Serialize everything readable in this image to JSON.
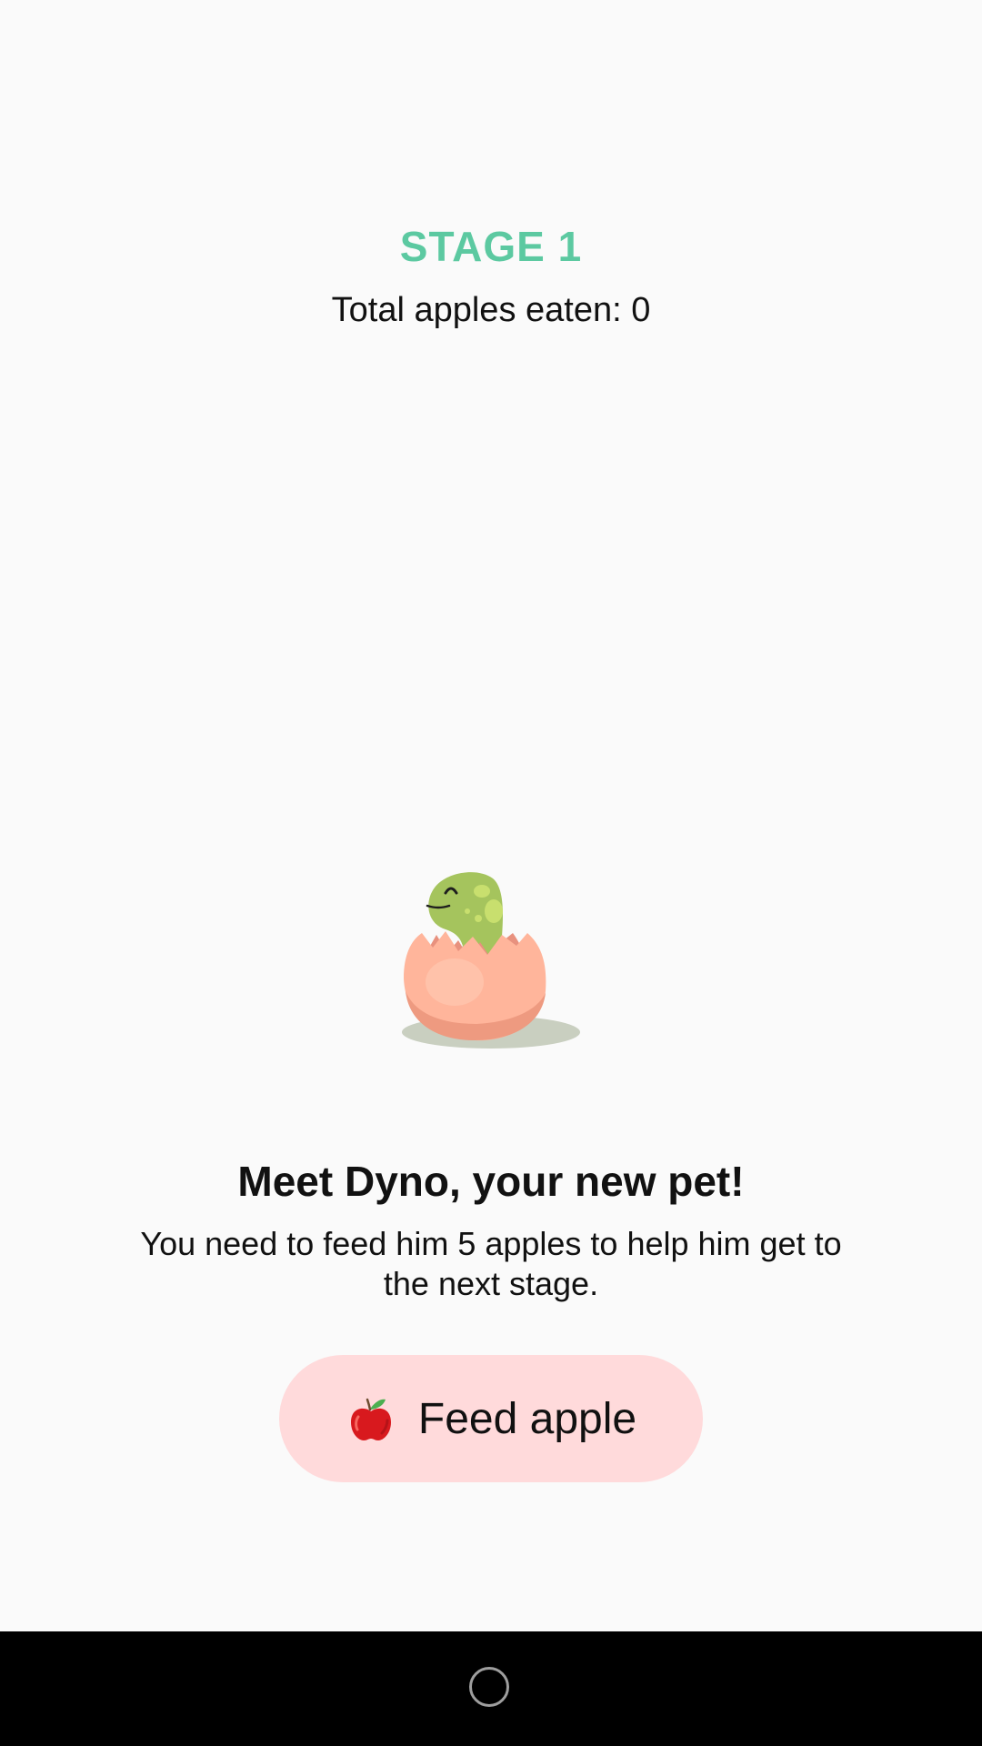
{
  "header": {
    "stage_label": "STAGE 1",
    "apples_eaten_text": "Total apples eaten: 0"
  },
  "pet": {
    "icon": "baby-dino-in-egg-icon"
  },
  "intro": {
    "headline": "Meet Dyno, your new pet!",
    "description": "You need to feed him 5 apples to help him get to the next stage."
  },
  "feed_button": {
    "icon": "apple-icon",
    "label": "Feed apple"
  },
  "nav": {
    "home_icon": "home-circle-icon"
  },
  "colors": {
    "stage_accent": "#5cc9a1",
    "button_background": "#ffdadb",
    "page_background": "#fafafa",
    "nav_background": "#000000"
  }
}
